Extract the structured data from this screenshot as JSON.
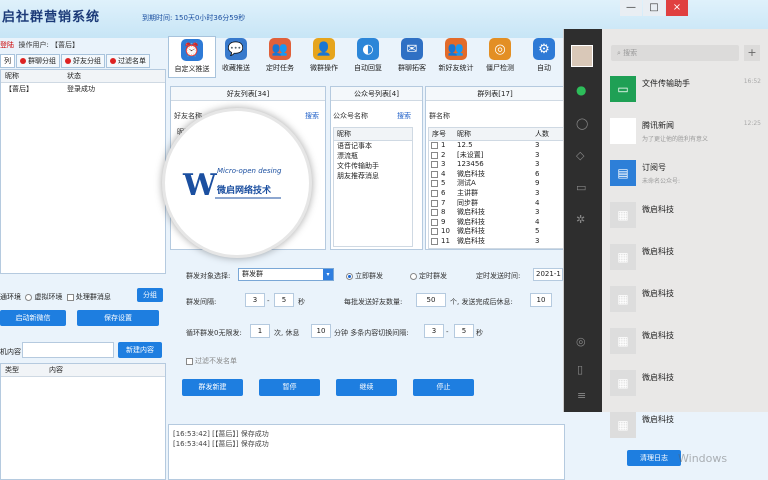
{
  "app": {
    "title": "启社群营销系统",
    "expire": "到期时间: 150天0小时36分59秒",
    "close_glyph": "×",
    "min_glyph": "—",
    "max_glyph": "□"
  },
  "user": {
    "lbl_a": "登陆",
    "lbl_b": "操作用户: 【蔷后】"
  },
  "tabs": [
    "列",
    "群聊分组",
    "好友分组",
    "过滤名单"
  ],
  "left_table": {
    "cols": [
      "昵称",
      "状态"
    ],
    "rows": [
      {
        "name": "【蔷后】",
        "status": "登录成功"
      }
    ]
  },
  "mode": {
    "opt1": "通环境",
    "opt2": "虚拟环境",
    "opt3": "处理群消息",
    "group_btn": "分组"
  },
  "buttons": {
    "start_wechat": "启动新微信",
    "save_settings": "保存设置",
    "new_content": "新建内容",
    "send_new": "群发新建",
    "pause": "暂停",
    "continue": "继续",
    "stop": "停止",
    "clear_log": "清理日志"
  },
  "content_label": "机内容",
  "bottom_table": {
    "cols": [
      "类型",
      "内容"
    ]
  },
  "toolbar": [
    {
      "label": "自定义推送",
      "color": "#2e7ad6",
      "glyph": "⏰"
    },
    {
      "label": "收藏推送",
      "color": "#3779cc",
      "glyph": "💬"
    },
    {
      "label": "定时任务",
      "color": "#e0603a",
      "glyph": "👥"
    },
    {
      "label": "微群操作",
      "color": "#e6a41c",
      "glyph": "👤"
    },
    {
      "label": "自动回复",
      "color": "#2c86d8",
      "glyph": "◐"
    },
    {
      "label": "群聊拓客",
      "color": "#2f70c4",
      "glyph": "✉"
    },
    {
      "label": "新好友统计",
      "color": "#e36b2a",
      "glyph": "👥"
    },
    {
      "label": "僵尸检测",
      "color": "#e38f24",
      "glyph": "◎"
    },
    {
      "label": "自动",
      "color": "#2e7ad6",
      "glyph": "⚙"
    }
  ],
  "friends_panel": {
    "title": "好友列表[34]",
    "search_label": "好友名称",
    "search_btn": "搜索",
    "col": "昵称"
  },
  "official_panel": {
    "title": "公众号列表[4]",
    "search_label": "公众号名称",
    "search_btn": "搜索",
    "col": "昵称",
    "items": [
      "语音记事本",
      "漂流瓶",
      "文件传输助手",
      "朋友推荐消息"
    ]
  },
  "group_panel": {
    "title": "群列表[17]",
    "search_label": "群名称",
    "cols": [
      "序号",
      "昵称",
      "人数"
    ],
    "rows": [
      {
        "no": "1",
        "name": "12.5",
        "count": "3"
      },
      {
        "no": "2",
        "name": "[未设置]",
        "count": "3"
      },
      {
        "no": "3",
        "name": "123456",
        "count": "3"
      },
      {
        "no": "4",
        "name": "微启科技",
        "count": "6"
      },
      {
        "no": "5",
        "name": "测试A",
        "count": "9"
      },
      {
        "no": "6",
        "name": "主讲群",
        "count": "3"
      },
      {
        "no": "7",
        "name": "同步群",
        "count": "4"
      },
      {
        "no": "8",
        "name": "微启科技",
        "count": "3"
      },
      {
        "no": "9",
        "name": "微启科技",
        "count": "4"
      },
      {
        "no": "10",
        "name": "微启科技",
        "count": "5"
      },
      {
        "no": "11",
        "name": "微启科技",
        "count": "3"
      }
    ]
  },
  "settings": {
    "target_label": "群发对象选择:",
    "target_value": "群发群",
    "now_label": "立即群发",
    "timed_label": "定时群发",
    "time_label": "定时发送时间:",
    "time_value": "2021-1",
    "interval_label": "群发间隔:",
    "interval_a": "3",
    "interval_b": "5",
    "sec": "秒",
    "batch_label": "每批发送好友数量:",
    "batch_value": "50",
    "batch_unit": "个, 发送完成后休息:",
    "rest_value": "10",
    "loop_label": "循环群发0无限发:",
    "loop_value": "1",
    "loop_unit": "次, 休息",
    "loop_rest": "10",
    "loop_min": "分钟 多条内容切换间隔:",
    "switch_a": "3",
    "switch_b": "5",
    "switch_sec": "秒",
    "dash": "-",
    "filter_label": "过滤不发名单"
  },
  "log": [
    "[16:53:42] [【蔷后】] 保存成功",
    "[16:53:44] [【蔷后】] 保存成功"
  ],
  "watermark": "Windows",
  "wechat": {
    "search_placeholder": "搜索",
    "add_glyph": "+",
    "chats": [
      {
        "name": "文件传输助手",
        "sub": "",
        "time": "16:52",
        "color": "#1fa055",
        "glyph": "▭"
      },
      {
        "name": "腾讯新闻",
        "sub": "为了更让他的胜利有意义",
        "time": "12:25",
        "color": "#fff",
        "glyph": "◍"
      },
      {
        "name": "订阅号",
        "sub": "未命名公众号:",
        "time": "",
        "color": "#2d7fd8",
        "glyph": "▤"
      },
      {
        "name": "微启科技",
        "sub": "",
        "time": "",
        "color": "#ddd",
        "glyph": "▦"
      },
      {
        "name": "微启科技",
        "sub": "",
        "time": "",
        "color": "#ddd",
        "glyph": "▦"
      },
      {
        "name": "微启科技",
        "sub": "",
        "time": "",
        "color": "#ddd",
        "glyph": "▦"
      },
      {
        "name": "微启科技",
        "sub": "",
        "time": "",
        "color": "#ddd",
        "glyph": "▦"
      },
      {
        "name": "微启科技",
        "sub": "",
        "time": "",
        "color": "#ddd",
        "glyph": "▦"
      },
      {
        "name": "微启科技",
        "sub": "",
        "time": "",
        "color": "#ddd",
        "glyph": "▦"
      }
    ]
  },
  "logo": {
    "text": "微启网络技术",
    "sub": "Micro-open desing"
  }
}
